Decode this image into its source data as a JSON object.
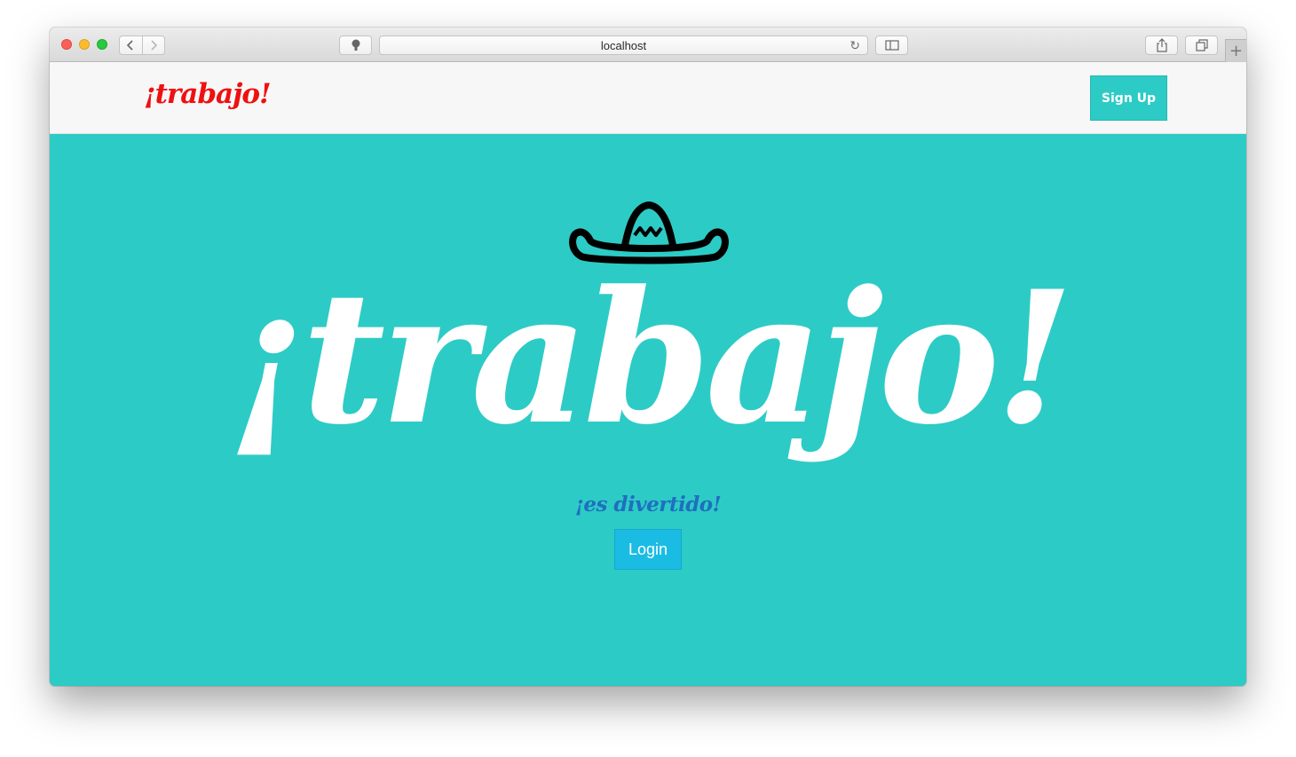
{
  "browser": {
    "url": "localhost",
    "back_icon": "chevron-left-icon",
    "forward_icon": "chevron-right-icon",
    "new_tab_label": "+"
  },
  "navbar": {
    "brand": "¡trabajo!",
    "signup_label": "Sign Up"
  },
  "hero": {
    "title": "¡trabajo!",
    "tagline": "¡es divertido!",
    "login_label": "Login",
    "icon": "sombrero-icon"
  },
  "colors": {
    "background": "#2dcbc6",
    "brand": "#ee1111",
    "tagline": "#1f6fbf",
    "login_button": "#1bbce3"
  }
}
